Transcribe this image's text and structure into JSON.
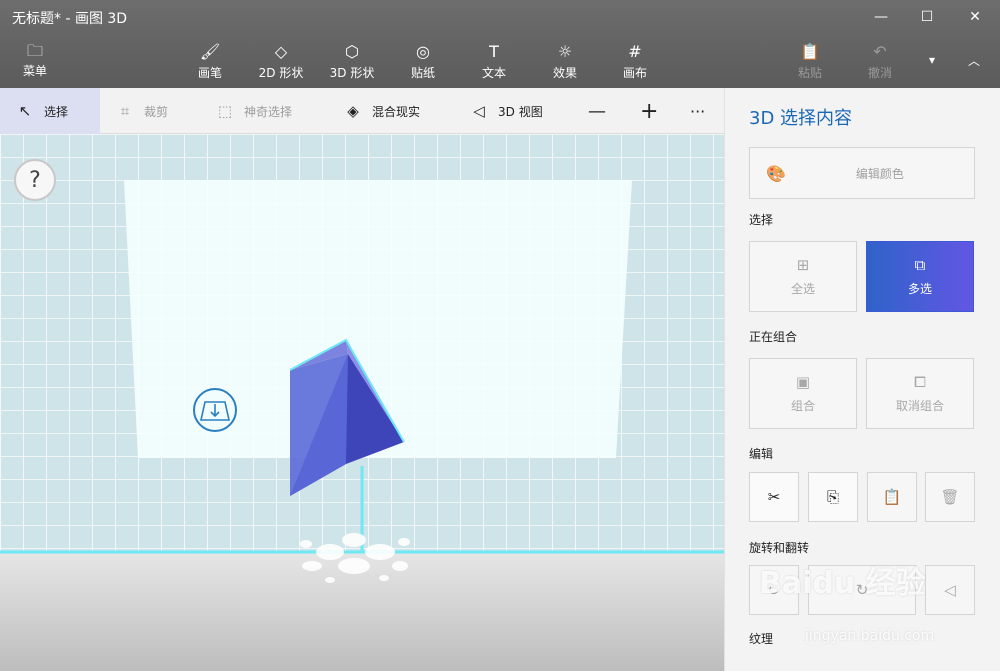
{
  "window": {
    "title": "无标题* - 画图 3D",
    "controls": {
      "minimize": "—",
      "maximize": "☐",
      "close": "✕"
    }
  },
  "toolbar": {
    "menu_label": "菜单",
    "tools": [
      {
        "label": "画笔",
        "icon": "brush-icon"
      },
      {
        "label": "2D 形状",
        "icon": "shape-2d-icon"
      },
      {
        "label": "3D 形状",
        "icon": "shape-3d-icon"
      },
      {
        "label": "贴纸",
        "icon": "sticker-icon"
      },
      {
        "label": "文本",
        "icon": "text-icon"
      },
      {
        "label": "效果",
        "icon": "effects-icon"
      },
      {
        "label": "画布",
        "icon": "canvas-icon"
      }
    ],
    "paste_label": "粘贴",
    "undo_label": "撤消"
  },
  "subtoolbar": {
    "select_label": "选择",
    "crop_label": "裁剪",
    "magic_select_label": "神奇选择",
    "mixed_reality_label": "混合现实",
    "view3d_label": "3D 视图",
    "zoom_out": "—",
    "zoom_in": "+",
    "more": "···"
  },
  "canvas": {
    "help_label": "?"
  },
  "panel": {
    "title": "3D 选择内容",
    "edit_color_label": "编辑颜色",
    "select_section": "选择",
    "select_all_label": "全选",
    "multi_select_label": "多选",
    "group_section": "正在组合",
    "group_label": "组合",
    "ungroup_label": "取消组合",
    "edit_section": "编辑",
    "rotate_section": "旋转和翻转",
    "texture_section": "纹理"
  },
  "watermark": "Baidu 经验",
  "watermark_url": "jingyan.baidu.com",
  "colors": {
    "accent_blue": "#1b68b7",
    "active_tile_start": "#2f63c9",
    "active_tile_end": "#6256e3",
    "toolbar_bg": "#5f5f5f",
    "object_blue": "#4a4fd0",
    "grid_cyan": "#6fe8f5"
  }
}
